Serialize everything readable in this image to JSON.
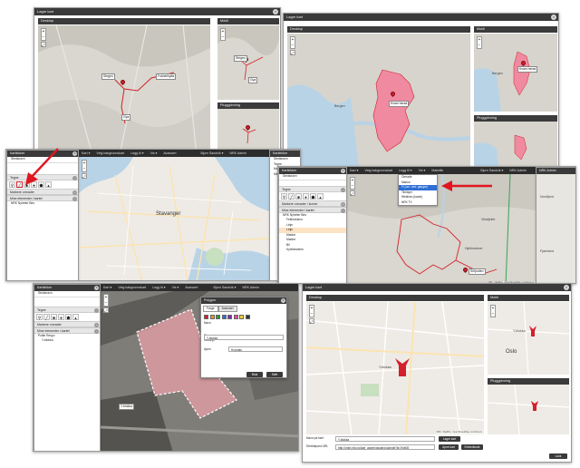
{
  "win1": {
    "title": "Lagre kart",
    "desktop_header": "Desktop",
    "mobil_header": "Mobil",
    "plugg_header": "Pluggpinning",
    "labels": [
      "Stegen",
      "Fokhellhytta",
      "Gya"
    ],
    "mobil_labels": [
      "Stegen",
      "Gya"
    ]
  },
  "win2": {
    "title": "Lagre kart",
    "desktop_header": "Desktop",
    "mobil_header": "Mobil",
    "plugg_header": "Pluggpinning",
    "label": "Kvam herad",
    "city": "Bergen",
    "mobil_label": "Kvam herad",
    "mobil_city": "Bergen",
    "attribution": "NRK, MapBox, OpenStreetMap contributors"
  },
  "win3": {
    "topbar": [
      "Kart ▾",
      "Velg bakgrunnskart",
      "Legg til ▾",
      "Vis ▾",
      "Avancert",
      "Bjorn Sandvik ▾",
      "NRK Admin"
    ],
    "panel_title": "Kartlekker",
    "panel_search": "Stedsnavn",
    "sec_tegne": "Tegne",
    "sec_markers": "Markere omrader",
    "sec_mine": "Mine elementer i kartet",
    "items": [
      "NRK Nyheter Bes"
    ],
    "city": "Stavanger",
    "right_panel": "Kartlekker",
    "right_items": [
      "Stedsnavn",
      "Tegne",
      "Markere omrader",
      "Mine elementer i kartet"
    ]
  },
  "win4": {
    "topbar": [
      "Kart ▾",
      "Velg bakgrunnskart",
      "Legg til ▾",
      "Vis ▾",
      "Malstille",
      "Bjorn Sandvik ▾",
      "NRK Admin"
    ],
    "panel_title": "Kartlekker",
    "panel_search": "Stedsnavn",
    "sec_tegne": "Tegne",
    "sec_markers": "Markere omrader / kurver",
    "sec_mine": "Mine elementer i kartet",
    "tree": [
      "NRK Nyheter Bes",
      "Fellesrekmo",
      "Linje",
      "Linje",
      "Marker",
      "Marker",
      "Bil",
      "Kyrkheweien"
    ],
    "menu": [
      "Omrade",
      "Markor",
      "Fl (om. omr. gaugar)",
      "Tilelayer",
      "Weblimn (komb)",
      "NRK TV"
    ],
    "map_labels": [
      "Vikafjellet",
      "Hjelleweiner",
      "Sirfjorden",
      "Nordfjord",
      "Fjaerland"
    ],
    "attribution": "NRK, MapBox, OpenStreetMap contributors"
  },
  "win5": {
    "topbar": [
      "Kart ▾",
      "Velg bakgrunnskart",
      "Legg til ▾",
      "Vis ▾",
      "Avancert",
      "Bjorn Sandvik ▾",
      "NRK Admin"
    ],
    "panel_title": "Kartlekker",
    "panel_search": "Stedsnavn",
    "sec_tegne": "Tegne",
    "sec_markers": "Markere omrader",
    "sec_mine": "Mine elementer i kartet",
    "tree": [
      "Polite Resyo",
      "Y-blokka"
    ],
    "dialog_title": "Polygon",
    "dialog_tabs": [
      "Farge",
      "Avansert"
    ],
    "dialog_fields": [
      "Navn",
      "Y-blokka",
      "Plassering",
      "Kartlinje"
    ],
    "dialog_select": "Hvordan",
    "dialog_check": "Apen",
    "dialog_buttons": [
      "Bruk",
      "Slett"
    ],
    "swatches": [
      "#d4202c",
      "#f28c28",
      "#2e9b3c",
      "#2e6fd6",
      "#7b2fb0",
      "#e54b9e",
      "#f2d22e",
      "#333333"
    ],
    "map_label": "Y-blokka"
  },
  "win6": {
    "title": "Lagre kart",
    "desktop_header": "Desktop",
    "mobil_header": "Mobil",
    "plugg_header": "Pluggpinning",
    "label": "Y-blokka",
    "city": "Oslo",
    "mobil_label": "Y-blokka",
    "attribution": "NRK, MapBox, OpenStreetMap contributors",
    "name_label": "Navn pa kart",
    "name_value": "Y-blokka",
    "save_button": "Lagre kart",
    "url_label": "Direktepost URL",
    "url_value": "http://nrkrt.nrk.no/kart_appen/plugin/pluginplt?id=94e08",
    "copy_button": "Apne kart",
    "embed_button": "Embedkode",
    "close_button": "Lukk"
  },
  "colors": {
    "accent_red": "#d4202c",
    "polygon_fill": "#f08aa0",
    "header_dark": "#3a3a3a"
  }
}
